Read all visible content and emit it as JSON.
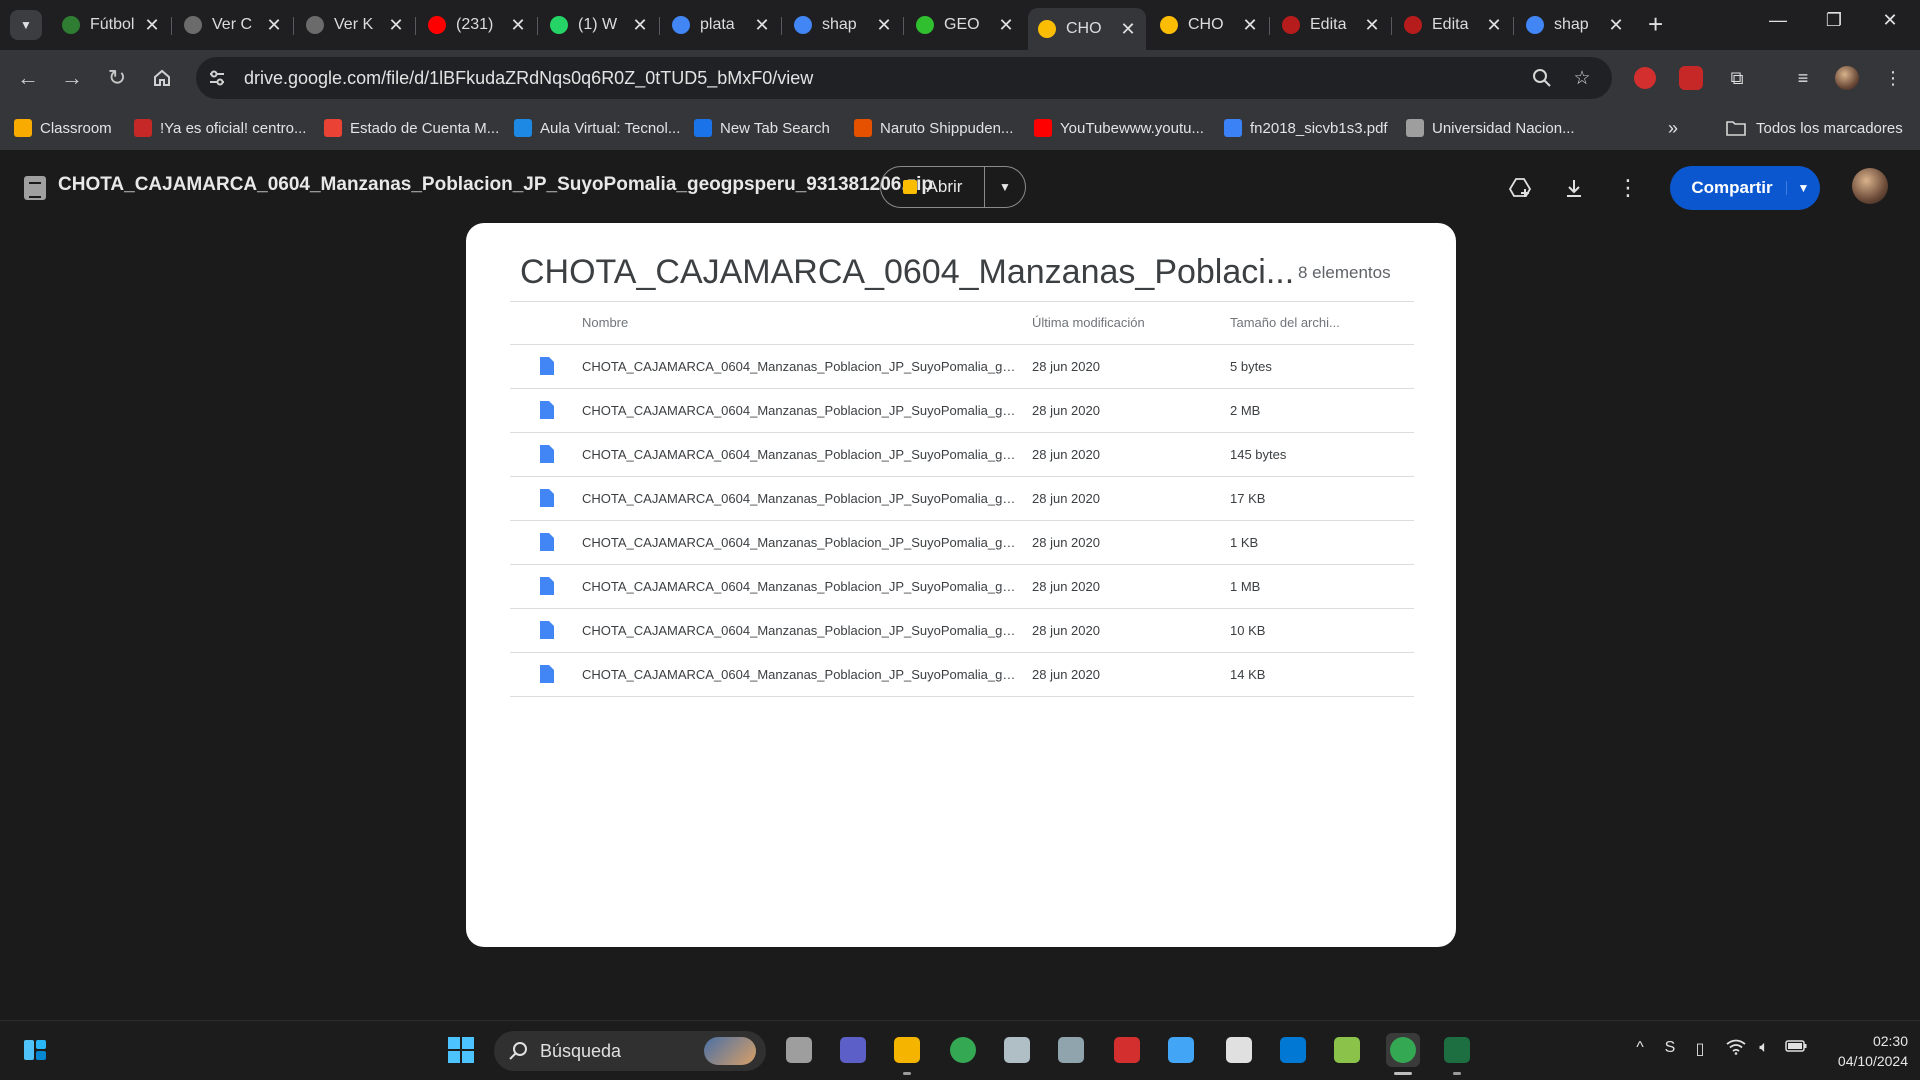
{
  "browser": {
    "tabs": [
      {
        "label": "Fútbol",
        "favicon": "soccer-ball-icon",
        "color": "#2e7d32"
      },
      {
        "label": "Ver C",
        "favicon": "globe-icon",
        "color": "#6b6b6b"
      },
      {
        "label": "Ver K",
        "favicon": "globe-icon",
        "color": "#6b6b6b"
      },
      {
        "label": "(231)",
        "favicon": "youtube-icon",
        "color": "#ff0000"
      },
      {
        "label": "(1) W",
        "favicon": "whatsapp-icon",
        "color": "#25d366"
      },
      {
        "label": "plata",
        "favicon": "google-icon",
        "color": "#4285f4"
      },
      {
        "label": "shap",
        "favicon": "google-icon",
        "color": "#4285f4"
      },
      {
        "label": "GEO",
        "favicon": "geo-icon",
        "color": "#2fbf2f"
      },
      {
        "label": "CHO",
        "favicon": "google-drive-icon",
        "color": "#fbbc04"
      },
      {
        "label": "CHO",
        "favicon": "google-drive-icon",
        "color": "#fbbc04"
      },
      {
        "label": "Edita",
        "favicon": "edit-doc-icon",
        "color": "#b71c1c"
      },
      {
        "label": "Edita",
        "favicon": "edit-doc-icon",
        "color": "#b71c1c"
      },
      {
        "label": "shap",
        "favicon": "google-icon",
        "color": "#4285f4"
      }
    ],
    "active_tab_index": 8,
    "url": "drive.google.com/file/d/1lBFkudaZRdNqs0q6R0Z_0tTUD5_bMxF0/view",
    "bookmarks": [
      {
        "label": "Classroom",
        "icon": "classroom-icon",
        "color": "#f9ab00"
      },
      {
        "label": "!Ya es oficial! centro...",
        "icon": "peru-flag-icon",
        "color": "#c62828"
      },
      {
        "label": "Estado de Cuenta M...",
        "icon": "gmail-icon",
        "color": "#ea4335"
      },
      {
        "label": "Aula Virtual: Tecnol...",
        "icon": "aula-virtual-icon",
        "color": "#1e88e5"
      },
      {
        "label": "New Tab Search",
        "icon": "search-icon",
        "color": "#1a73e8"
      },
      {
        "label": "Naruto Shippuden...",
        "icon": "naruto-icon",
        "color": "#e65100"
      },
      {
        "label": "YouTubewww.youtu...",
        "icon": "youtube-icon",
        "color": "#ff0000"
      },
      {
        "label": "fn2018_sicvb1s3.pdf",
        "icon": "wordpress-icon",
        "color": "#3b82f6"
      },
      {
        "label": "Universidad Nacion...",
        "icon": "globe-icon",
        "color": "#9e9e9e"
      }
    ],
    "all_bookmarks_label": "Todos los marcadores"
  },
  "viewer": {
    "file_title": "CHOTA_CAJAMARCA_0604_Manzanas_Poblacion_JP_SuyoPomalia_geogpsperu_931381206.zip",
    "open_label": "Abrir",
    "share_label": "Compartir",
    "accent_color": "#0b57d0"
  },
  "zip_preview": {
    "title": "CHOTA_CAJAMARCA_0604_Manzanas_Poblaci...",
    "count_label": "8 elementos",
    "columns": {
      "name": "Nombre",
      "modified": "Última modificación",
      "size": "Tamaño del archi..."
    },
    "files": [
      {
        "name": "CHOTA_CAJAMARCA_0604_Manzanas_Poblacion_JP_SuyoPomalia_geo...",
        "modified": "28 jun 2020",
        "size": "5 bytes"
      },
      {
        "name": "CHOTA_CAJAMARCA_0604_Manzanas_Poblacion_JP_SuyoPomalia_geo...",
        "modified": "28 jun 2020",
        "size": "2 MB"
      },
      {
        "name": "CHOTA_CAJAMARCA_0604_Manzanas_Poblacion_JP_SuyoPomalia_geo...",
        "modified": "28 jun 2020",
        "size": "145 bytes"
      },
      {
        "name": "CHOTA_CAJAMARCA_0604_Manzanas_Poblacion_JP_SuyoPomalia_geo...",
        "modified": "28 jun 2020",
        "size": "17 KB"
      },
      {
        "name": "CHOTA_CAJAMARCA_0604_Manzanas_Poblacion_JP_SuyoPomalia_geo...",
        "modified": "28 jun 2020",
        "size": "1 KB"
      },
      {
        "name": "CHOTA_CAJAMARCA_0604_Manzanas_Poblacion_JP_SuyoPomalia_geo...",
        "modified": "28 jun 2020",
        "size": "1 MB"
      },
      {
        "name": "CHOTA_CAJAMARCA_0604_Manzanas_Poblacion_JP_SuyoPomalia_geo...",
        "modified": "28 jun 2020",
        "size": "10 KB"
      },
      {
        "name": "CHOTA_CAJAMARCA_0604_Manzanas_Poblacion_JP_SuyoPomalia_geo...",
        "modified": "28 jun 2020",
        "size": "14 KB"
      }
    ]
  },
  "taskbar": {
    "search_label": "Búsqueda",
    "clock_time": "02:30",
    "clock_date": "04/10/2024",
    "apps": [
      {
        "name": "task-view-icon",
        "color": "#9e9e9e"
      },
      {
        "name": "meet-icon",
        "color": "#5b5fc7"
      },
      {
        "name": "file-explorer-icon",
        "color": "#f4b400"
      },
      {
        "name": "chrome-icon",
        "color": "#34a853"
      },
      {
        "name": "network-app-icon",
        "color": "#b0bec5"
      },
      {
        "name": "camera-icon",
        "color": "#90a4ae"
      },
      {
        "name": "acrobat-icon",
        "color": "#d32f2f"
      },
      {
        "name": "globe-app-icon",
        "color": "#42a5f5"
      },
      {
        "name": "java-icon",
        "color": "#e0e0e0"
      },
      {
        "name": "store-icon",
        "color": "#0078d4"
      },
      {
        "name": "qgis-icon",
        "color": "#8bc34a"
      },
      {
        "name": "chrome-profile-icon",
        "color": "#34a853"
      },
      {
        "name": "excel-icon",
        "color": "#1d6f42"
      }
    ]
  }
}
